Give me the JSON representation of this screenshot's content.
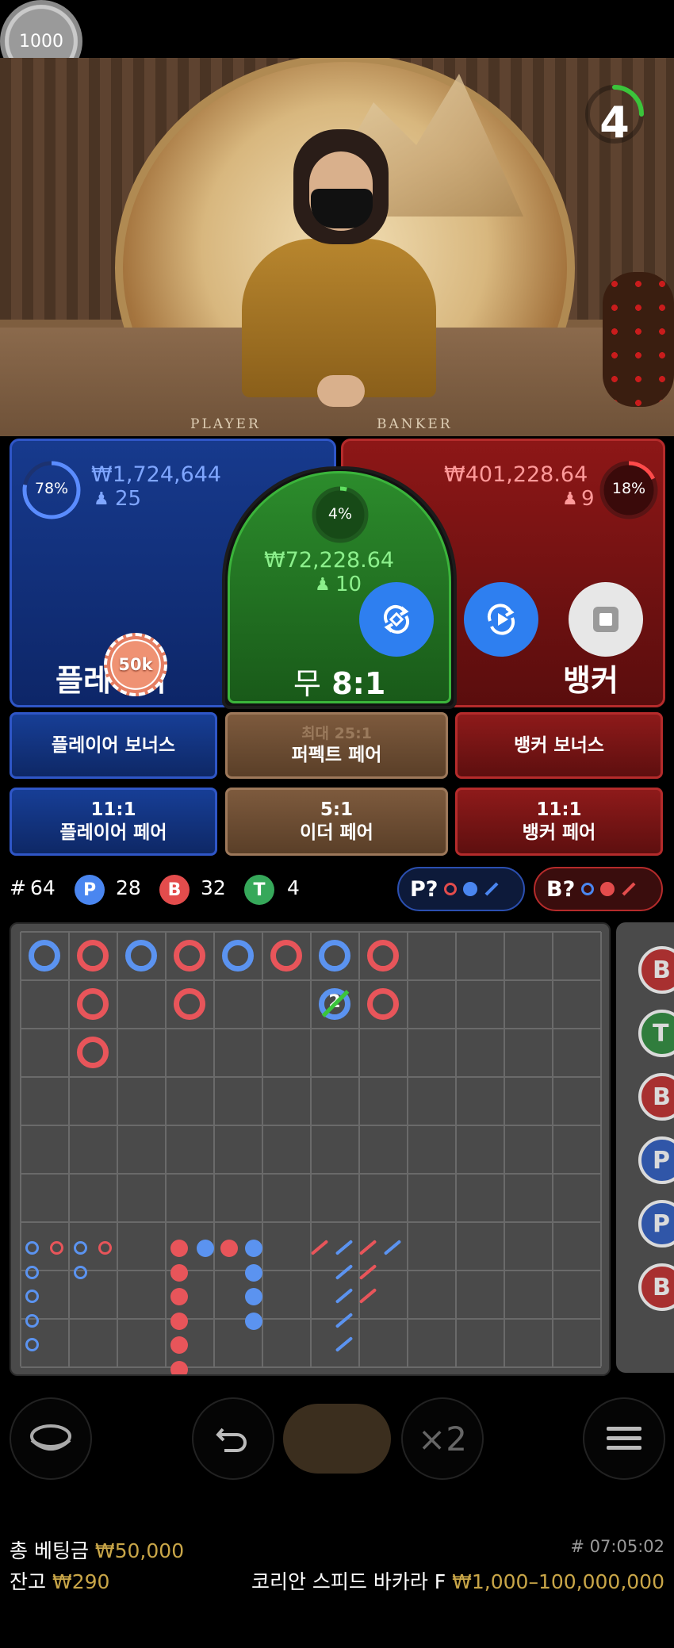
{
  "timer": {
    "value": "4"
  },
  "table": {
    "player_word": "PLAYER",
    "banker_word": "BANKER"
  },
  "player": {
    "percent": "78%",
    "amount": "₩1,724,644",
    "count": "25",
    "label": "플레이어",
    "chip": "50k",
    "color": "#2f56c7"
  },
  "tie": {
    "percent": "4%",
    "amount": "₩72,228.64",
    "count": "10",
    "label": "무",
    "payout": "8:1",
    "color": "#3bb43b"
  },
  "banker": {
    "percent": "18%",
    "amount": "₩401,228.64",
    "count": "9",
    "label": "뱅커",
    "color": "#b52b2b"
  },
  "side_bets": {
    "row1": {
      "player_bonus": "플레이어 보너스",
      "perfect_pair_odds": "최대 25:1",
      "perfect_pair": "퍼펙트 페어",
      "banker_bonus": "뱅커 보너스"
    },
    "row2": {
      "player_pair_odds": "11:1",
      "player_pair": "플레이어 페어",
      "either_pair_odds": "5:1",
      "either_pair": "이더 페어",
      "banker_pair_odds": "11:1",
      "banker_pair": "뱅커 페어"
    }
  },
  "stats": {
    "hash": "#",
    "total": "64",
    "p_label": "P",
    "p_count": "28",
    "b_label": "B",
    "b_count": "32",
    "t_label": "T",
    "t_count": "4"
  },
  "ask": {
    "player": "P?",
    "banker": "B?"
  },
  "roadmap": {
    "big_road": [
      {
        "col": 0,
        "row": 0,
        "r": "P"
      },
      {
        "col": 1,
        "row": 0,
        "r": "B"
      },
      {
        "col": 1,
        "row": 1,
        "r": "B"
      },
      {
        "col": 1,
        "row": 2,
        "r": "B"
      },
      {
        "col": 2,
        "row": 0,
        "r": "P"
      },
      {
        "col": 3,
        "row": 0,
        "r": "B"
      },
      {
        "col": 3,
        "row": 1,
        "r": "B"
      },
      {
        "col": 4,
        "row": 0,
        "r": "P"
      },
      {
        "col": 5,
        "row": 0,
        "r": "B"
      },
      {
        "col": 6,
        "row": 0,
        "r": "P"
      },
      {
        "col": 6,
        "row": 1,
        "r": "P",
        "tie_count": "2"
      },
      {
        "col": 7,
        "row": 0,
        "r": "B"
      },
      {
        "col": 7,
        "row": 1,
        "r": "B"
      }
    ],
    "tie_label": "2",
    "side_labels": [
      "B",
      "T",
      "B",
      "P",
      "P",
      "B"
    ]
  },
  "toolbar": {
    "chip": "1000",
    "double": "×2"
  },
  "footer": {
    "total_bet_label": "총 베팅금",
    "total_bet": "₩50,000",
    "game_id": "# 07:05:02",
    "balance_label": "잔고",
    "balance": "₩290",
    "table_name": "코리안 스피드 바카라 F",
    "limits": "₩1,000–100,000,000"
  }
}
